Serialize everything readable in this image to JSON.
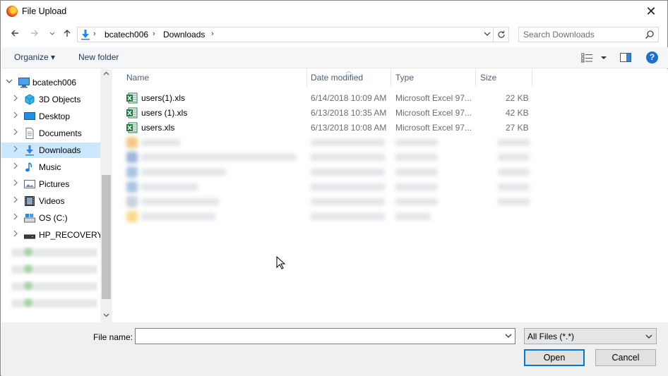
{
  "window": {
    "title": "File Upload",
    "close_glyph": "✕"
  },
  "nav_buttons": {
    "back": "back-arrow-icon",
    "forward": "forward-arrow-icon",
    "recent": "chevron-down-icon",
    "up": "up-arrow-icon"
  },
  "address": {
    "breadcrumbs": [
      "bcatech006",
      "Downloads"
    ],
    "separator": "›"
  },
  "search": {
    "placeholder": "Search Downloads"
  },
  "toolbar": {
    "organize_label": "Organize ▾",
    "new_folder_label": "New folder",
    "help_label": "?"
  },
  "nav_pane": {
    "items": [
      {
        "label": "bcatech006",
        "icon": "computer-icon",
        "indent": 0
      },
      {
        "label": "3D Objects",
        "icon": "3d-objects-icon",
        "indent": 1
      },
      {
        "label": "Desktop",
        "icon": "desktop-icon",
        "indent": 1
      },
      {
        "label": "Documents",
        "icon": "documents-icon",
        "indent": 1
      },
      {
        "label": "Downloads",
        "icon": "downloads-icon",
        "indent": 1,
        "selected": true
      },
      {
        "label": "Music",
        "icon": "music-icon",
        "indent": 1
      },
      {
        "label": "Pictures",
        "icon": "pictures-icon",
        "indent": 1
      },
      {
        "label": "Videos",
        "icon": "videos-icon",
        "indent": 1
      },
      {
        "label": "OS (C:)",
        "icon": "drive-icon",
        "indent": 1
      },
      {
        "label": "HP_RECOVERY (",
        "icon": "recovery-drive-icon",
        "indent": 1
      }
    ]
  },
  "file_list": {
    "columns": [
      "Name",
      "Date modified",
      "Type",
      "Size"
    ],
    "rows": [
      {
        "name": "users(1).xls",
        "date": "6/14/2018 10:09 AM",
        "type": "Microsoft Excel 97...",
        "size": "22 KB"
      },
      {
        "name": "users (1).xls",
        "date": "6/13/2018 10:35 AM",
        "type": "Microsoft Excel 97...",
        "size": "42 KB"
      },
      {
        "name": "users.xls",
        "date": "6/13/2018 10:08 AM",
        "type": "Microsoft Excel 97...",
        "size": "27 KB"
      }
    ]
  },
  "bottom": {
    "file_name_label": "File name:",
    "file_name_value": "",
    "filter_value": "All Files (*.*)",
    "open_label": "Open",
    "cancel_label": "Cancel"
  },
  "colors": {
    "accent": "#0078d7",
    "selected_bg": "#cce8ff",
    "toolbar_bg": "#f5f6f7",
    "bottom_bg": "#f0f0f0"
  }
}
